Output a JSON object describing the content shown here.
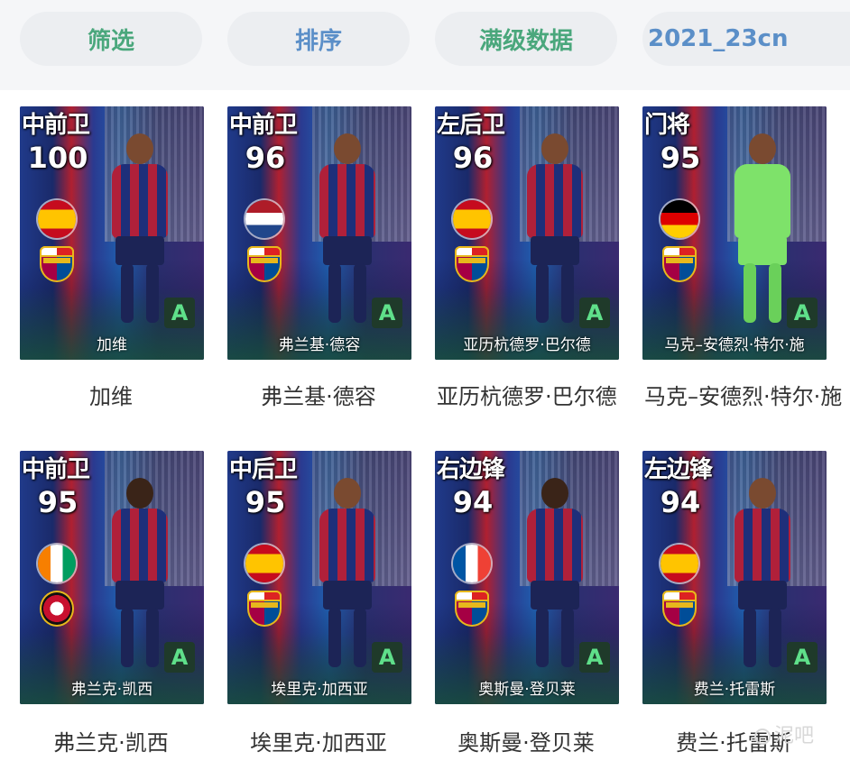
{
  "toolbar": {
    "filter": "筛选",
    "sort": "排序",
    "max_level": "满级数据",
    "version": "2021_23cn"
  },
  "cards": [
    {
      "position": "中前卫",
      "rating": "100",
      "card_name": "加维",
      "caption": "加维",
      "grade": "A",
      "nation": "spain",
      "club": "barcelona"
    },
    {
      "position": "中前卫",
      "rating": "96",
      "card_name": "弗兰基·德容",
      "caption": "弗兰基·德容",
      "grade": "A",
      "nation": "netherlands",
      "club": "barcelona"
    },
    {
      "position": "左后卫",
      "rating": "96",
      "card_name": "亚历杭德罗·巴尔德",
      "caption": "亚历杭德罗·巴尔德",
      "grade": "A",
      "nation": "spain",
      "club": "barcelona"
    },
    {
      "position": "门将",
      "rating": "95",
      "card_name": "马克–安德烈·特尔·施",
      "caption": "马克–安德烈·特尔·施",
      "grade": "A",
      "nation": "germany",
      "club": "barcelona"
    },
    {
      "position": "中前卫",
      "rating": "95",
      "card_name": "弗兰克·凯西",
      "caption": "弗兰克·凯西",
      "grade": "A",
      "nation": "ivory-coast",
      "club": "ac-milan"
    },
    {
      "position": "中后卫",
      "rating": "95",
      "card_name": "埃里克·加西亚",
      "caption": "埃里克·加西亚",
      "grade": "A",
      "nation": "spain",
      "club": "barcelona"
    },
    {
      "position": "右边锋",
      "rating": "94",
      "card_name": "奥斯曼·登贝莱",
      "caption": "奥斯曼·登贝莱",
      "grade": "A",
      "nation": "france",
      "club": "barcelona"
    },
    {
      "position": "左边锋",
      "rating": "94",
      "card_name": "费兰·托雷斯",
      "caption": "费兰·托雷斯",
      "grade": "A",
      "nation": "spain",
      "club": "barcelona"
    }
  ],
  "watermark": "泥吧"
}
